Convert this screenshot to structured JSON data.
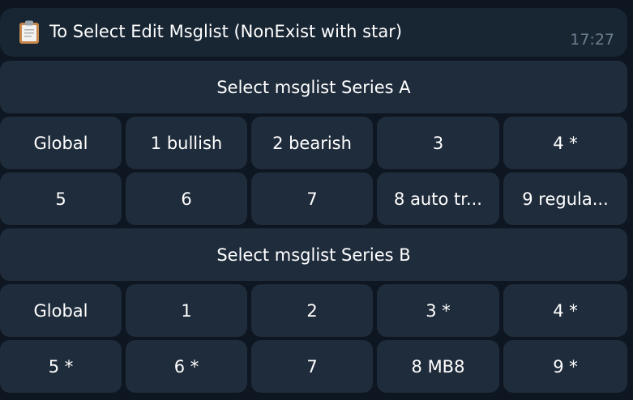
{
  "message": {
    "icon": "clipboard-icon",
    "title": "To Select Edit Msglist (NonExist with star)",
    "time": "17:27"
  },
  "keyboard": {
    "series_a_header": "Select msglist Series A",
    "series_a_rows": [
      [
        "Global",
        "1 bullish",
        "2 bearish",
        "3",
        "4 *"
      ],
      [
        "5",
        "6",
        "7",
        "8 auto tr...",
        "9 regula..."
      ]
    ],
    "series_b_header": "Select msglist Series B",
    "series_b_rows": [
      [
        "Global",
        "1",
        "2",
        "3 *",
        "4 *"
      ],
      [
        "5 *",
        "6 *",
        "7",
        "8 MB8",
        "9 *"
      ]
    ]
  },
  "colors": {
    "background": "#0e1621",
    "bubble": "#182533",
    "button": "#1f2c3b",
    "time_text": "#6d7f8f"
  }
}
